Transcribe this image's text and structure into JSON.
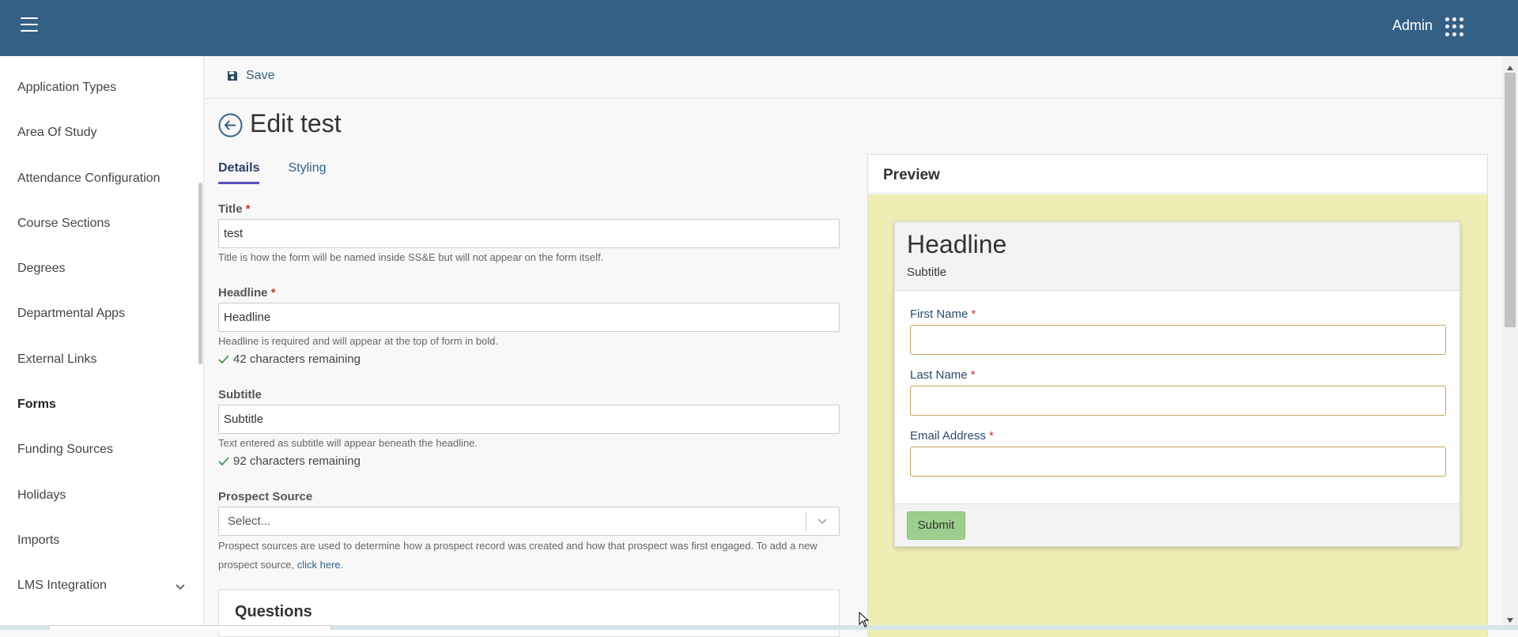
{
  "header": {
    "user_label": "Admin",
    "menu_icon": "hamburger-icon",
    "apps_icon": "grid-dots-icon",
    "bg_color": "#356086"
  },
  "sidebar": {
    "items": [
      {
        "label": "Application Types"
      },
      {
        "label": "Area Of Study"
      },
      {
        "label": "Attendance Configuration"
      },
      {
        "label": "Course Sections"
      },
      {
        "label": "Degrees"
      },
      {
        "label": "Departmental Apps"
      },
      {
        "label": "External Links"
      },
      {
        "label": "Forms",
        "active": true
      },
      {
        "label": "Funding Sources"
      },
      {
        "label": "Holidays"
      },
      {
        "label": "Imports"
      },
      {
        "label": "LMS Integration",
        "expandable": true
      }
    ]
  },
  "toolbar": {
    "save_label": "Save",
    "save_icon": "floppy-disk-icon"
  },
  "page": {
    "title": "Edit test",
    "back_icon": "arrow-left-circle-icon",
    "tabs": [
      {
        "label": "Details",
        "active": true
      },
      {
        "label": "Styling",
        "active": false
      }
    ]
  },
  "form": {
    "title_label": "Title",
    "title_value": "test",
    "title_help": "Title is how the form will be named inside SS&E but will not appear on the form itself.",
    "headline_label": "Headline",
    "headline_value": "Headline",
    "headline_help": "Headline is required and will appear at the top of form in bold.",
    "headline_remaining": "42 characters remaining",
    "subtitle_label": "Subtitle",
    "subtitle_value": "Subtitle",
    "subtitle_help": "Text entered as subtitle will appear beneath the headline.",
    "subtitle_remaining": "92 characters remaining",
    "required_marker": "*",
    "prospect_label": "Prospect Source",
    "prospect_placeholder": "Select...",
    "prospect_help": "Prospect sources are used to determine how a prospect record was created and how that prospect was first engaged. To add a new prospect source,",
    "prospect_link": "click here.",
    "questions_title": "Questions"
  },
  "preview": {
    "title": "Preview",
    "headline": "Headline",
    "subtitle": "Subtitle",
    "fields": [
      {
        "label": "First Name"
      },
      {
        "label": "Last Name"
      },
      {
        "label": "Email Address"
      }
    ],
    "submit_label": "Submit",
    "bg_color": "#eeeeb4"
  }
}
